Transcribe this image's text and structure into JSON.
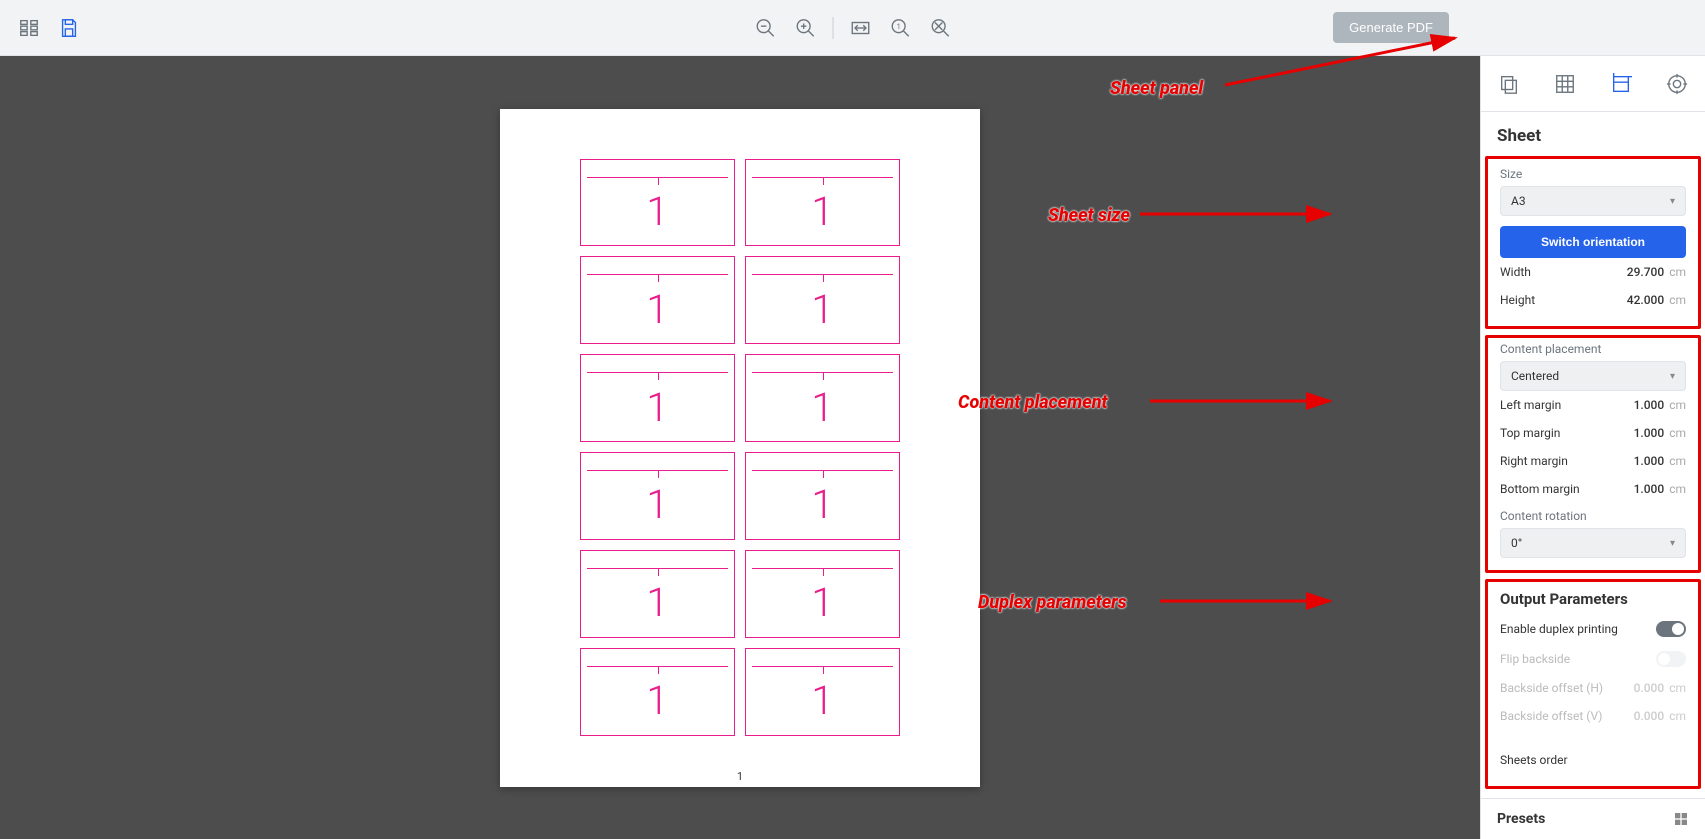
{
  "toolbar": {
    "generate_label": "Generate PDF"
  },
  "panel": {
    "title": "Sheet",
    "size_label": "Size",
    "size_value": "A3",
    "switch_label": "Switch orientation",
    "width_label": "Width",
    "width_value": "29.700",
    "height_label": "Height",
    "height_value": "42.000",
    "unit": "cm",
    "placement_label": "Content placement",
    "placement_value": "Centered",
    "left_margin_label": "Left margin",
    "left_margin_value": "1.000",
    "top_margin_label": "Top margin",
    "top_margin_value": "1.000",
    "right_margin_label": "Right margin",
    "right_margin_value": "1.000",
    "bottom_margin_label": "Bottom margin",
    "bottom_margin_value": "1.000",
    "rotation_label": "Content rotation",
    "rotation_value": "0°",
    "output_title": "Output Parameters",
    "duplex_label": "Enable duplex printing",
    "flip_label": "Flip backside",
    "offset_h_label": "Backside offset (H)",
    "offset_h_value": "0.000",
    "offset_v_label": "Backside offset (V)",
    "offset_v_value": "0.000",
    "sheets_order_label": "Sheets order",
    "presets_label": "Presets"
  },
  "canvas": {
    "card_number": "1",
    "page_number": "1"
  },
  "annotations": {
    "sheet_panel": "Sheet panel",
    "sheet_size": "Sheet size",
    "content_placement": "Content placement",
    "duplex_params": "Duplex parameters"
  }
}
